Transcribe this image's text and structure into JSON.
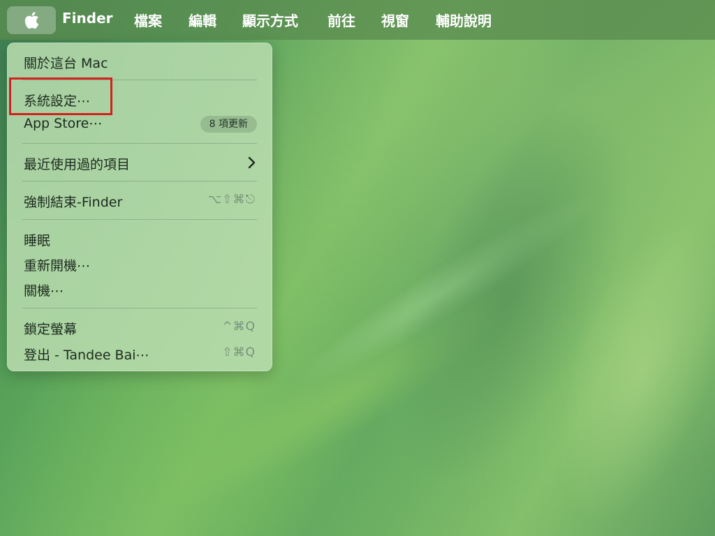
{
  "menubar": {
    "apple_icon": "apple-logo-icon",
    "items": [
      "Finder",
      "檔案",
      "編輯",
      "顯示方式",
      "前往",
      "視窗",
      "輔助說明"
    ]
  },
  "apple_menu": {
    "about": "關於這台 Mac",
    "system_settings": "系統設定⋯",
    "app_store": "App Store⋯",
    "app_store_badge": "8 項更新",
    "recent_items": "最近使用過的項目",
    "force_quit": "強制結束-Finder",
    "force_quit_shortcut": "⌥⇧⌘⎋",
    "sleep": "睡眠",
    "restart": "重新開機⋯",
    "shutdown": "關機⋯",
    "lock_screen": "鎖定螢幕",
    "lock_screen_shortcut": "^⌘Q",
    "logout": "登出 - Tandee Bai⋯",
    "logout_shortcut": "⇧⌘Q"
  },
  "colors": {
    "highlight": "#d52020",
    "menubar_text": "#ffffff"
  }
}
